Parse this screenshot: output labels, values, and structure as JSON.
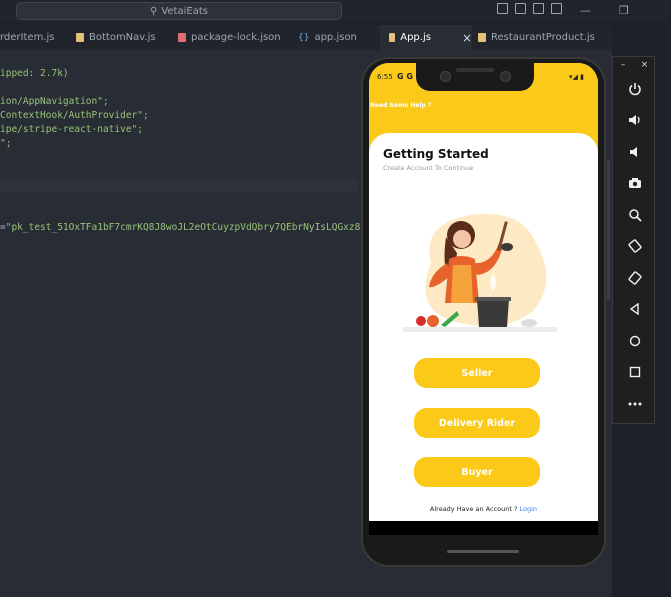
{
  "titlebar": {
    "search_text": "VetaiEats",
    "search_icon": "search-icon",
    "minimize": "—",
    "restore": "❐"
  },
  "tabs": [
    {
      "label": "rderItem.js",
      "icon": "js-file-icon"
    },
    {
      "label": "BottomNav.js",
      "icon": "js-file-icon"
    },
    {
      "label": "package-lock.json",
      "icon": "json-file-icon"
    },
    {
      "label": "app.json",
      "icon": "braces-icon"
    },
    {
      "label": "App.js",
      "icon": "js-file-icon",
      "active": true
    },
    {
      "label": "RestaurantProduct.js",
      "icon": "js-file-icon"
    }
  ],
  "code": {
    "line1": "ipped: 2.7k)",
    "line2": "ion/AppNavigation\";",
    "line3": "ContextHook/AuthProvider\";",
    "line4": "ipe/stripe-react-native\";",
    "line5": "\";",
    "line6_prefix": "=",
    "line6_str": "\"pk_test_51OxTFa1bF7cmrKQ8J8woJL2eOtCuyzpVdQbry7QEbrNyIsLQGxz8"
  },
  "phone": {
    "status_time": "6:55",
    "status_icons": "G G ☁ G",
    "status_right": "▾◢ ▮",
    "help_text": "Need Some Help ?",
    "title": "Getting Started",
    "subtitle": "Create Account To Continue",
    "buttons": {
      "seller": "Seller",
      "rider": "Delivery Rider",
      "buyer": "Buyer"
    },
    "account_text": "Already Have an Account ?",
    "login_link": "Login",
    "accent_color": "#fbc918"
  },
  "emulator": {
    "minimize": "–",
    "close": "×",
    "tools": [
      {
        "name": "power-icon",
        "glyph": "⏻"
      },
      {
        "name": "volume-up-icon",
        "glyph": "🔊"
      },
      {
        "name": "volume-down-icon",
        "glyph": "🔉"
      },
      {
        "name": "camera-icon",
        "glyph": "📷"
      },
      {
        "name": "zoom-icon",
        "glyph": "🔍"
      },
      {
        "name": "rotate-left-icon",
        "glyph": "⟲"
      },
      {
        "name": "rotate-right-icon",
        "glyph": "⟳"
      },
      {
        "name": "back-icon",
        "glyph": "◁"
      },
      {
        "name": "home-icon",
        "glyph": "○"
      },
      {
        "name": "overview-icon",
        "glyph": "□"
      },
      {
        "name": "more-icon",
        "glyph": "•••"
      }
    ]
  }
}
